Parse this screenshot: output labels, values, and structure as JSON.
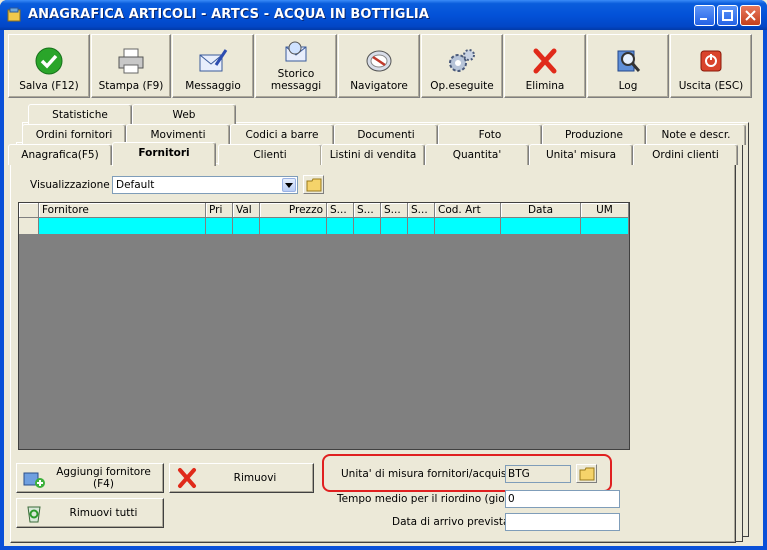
{
  "window": {
    "title": "ANAGRAFICA ARTICOLI - ARTCS - ACQUA IN BOTTIGLIA"
  },
  "toolbar": [
    {
      "label": "Salva (F12)",
      "icon": "check-icon"
    },
    {
      "label": "Stampa (F9)",
      "icon": "printer-icon"
    },
    {
      "label": "Messaggio",
      "icon": "envelope-pen-icon"
    },
    {
      "label1": "Storico",
      "label2": "messaggi",
      "icon": "envelope-search-icon"
    },
    {
      "label": "Navigatore",
      "icon": "compass-icon"
    },
    {
      "label": "Op.eseguite",
      "icon": "gears-icon"
    },
    {
      "label": "Elimina",
      "icon": "red-x-icon"
    },
    {
      "label": "Log",
      "icon": "log-search-icon"
    },
    {
      "label": "Uscita (ESC)",
      "icon": "exit-icon"
    }
  ],
  "tabs": {
    "row1": [
      "Statistiche",
      "Web"
    ],
    "row2": [
      "Ordini fornitori",
      "Movimenti",
      "Codici a barre",
      "Documenti",
      "Foto",
      "Produzione",
      "Note e descr."
    ],
    "row3": [
      "Anagrafica(F5)",
      "Fornitori",
      "Clienti",
      "Listini di vendita",
      "Quantita'",
      "Unita' misura",
      "Ordini clienti"
    ],
    "active": "Fornitori"
  },
  "view": {
    "label": "Visualizzazione :",
    "value": "Default"
  },
  "grid": {
    "columns": [
      "Fornitore",
      "Pri",
      "Val",
      "Prezzo",
      "S...",
      "S...",
      "S...",
      "S...",
      "Cod. Art",
      "Data",
      "UM"
    ]
  },
  "buttons": {
    "add_supplier": "Aggiungi fornitore (F4)",
    "remove": "Rimuovi",
    "remove_all": "Rimuovi tutti"
  },
  "fields": {
    "uom_label": "Unita' di misura fornitori/acquisto :",
    "uom_value": "BTG",
    "avg_time_label": "Tempo medio per il riordino (giorni) :",
    "avg_time_value": "0",
    "arrival_label": "Data di arrivo prevista :",
    "arrival_value": ""
  },
  "colors": {
    "title_bar": "#0a5ddc",
    "grid_row": "#00ffff",
    "highlight": "#e02020"
  }
}
